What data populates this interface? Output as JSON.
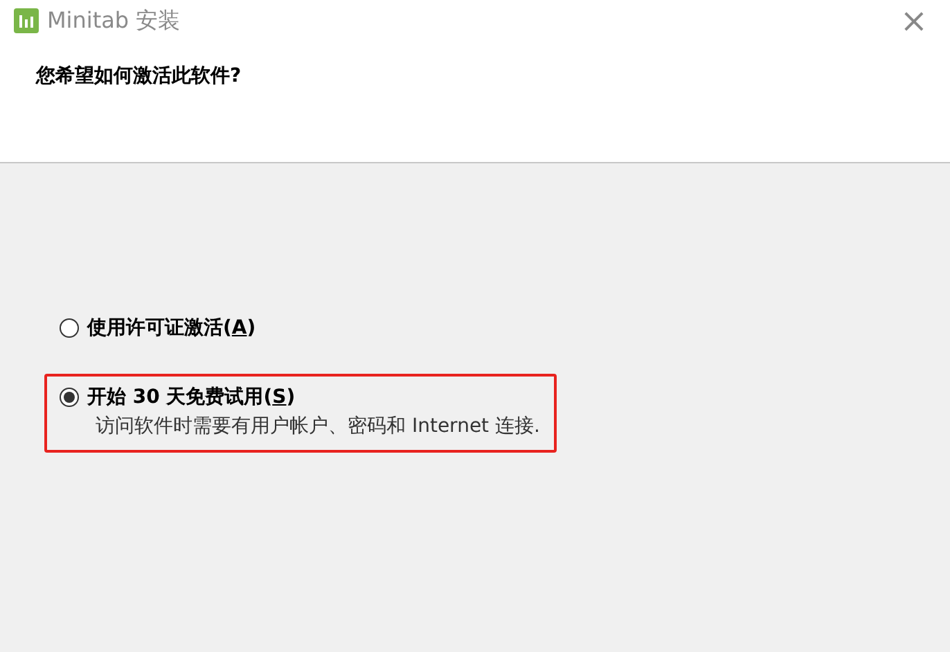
{
  "window": {
    "title": "Minitab 安装",
    "close_glyph": "×"
  },
  "heading": "您希望如何激活此软件?",
  "options": [
    {
      "label_before": "使用许可证激活(",
      "access_key": "A",
      "label_after": ")",
      "selected": false,
      "highlighted": false
    },
    {
      "label_before": "开始 30 天免费试用(",
      "access_key": "S",
      "label_after": ")",
      "description": "访问软件时需要有用户帐户、密码和 Internet 连接.",
      "selected": true,
      "highlighted": true
    }
  ]
}
